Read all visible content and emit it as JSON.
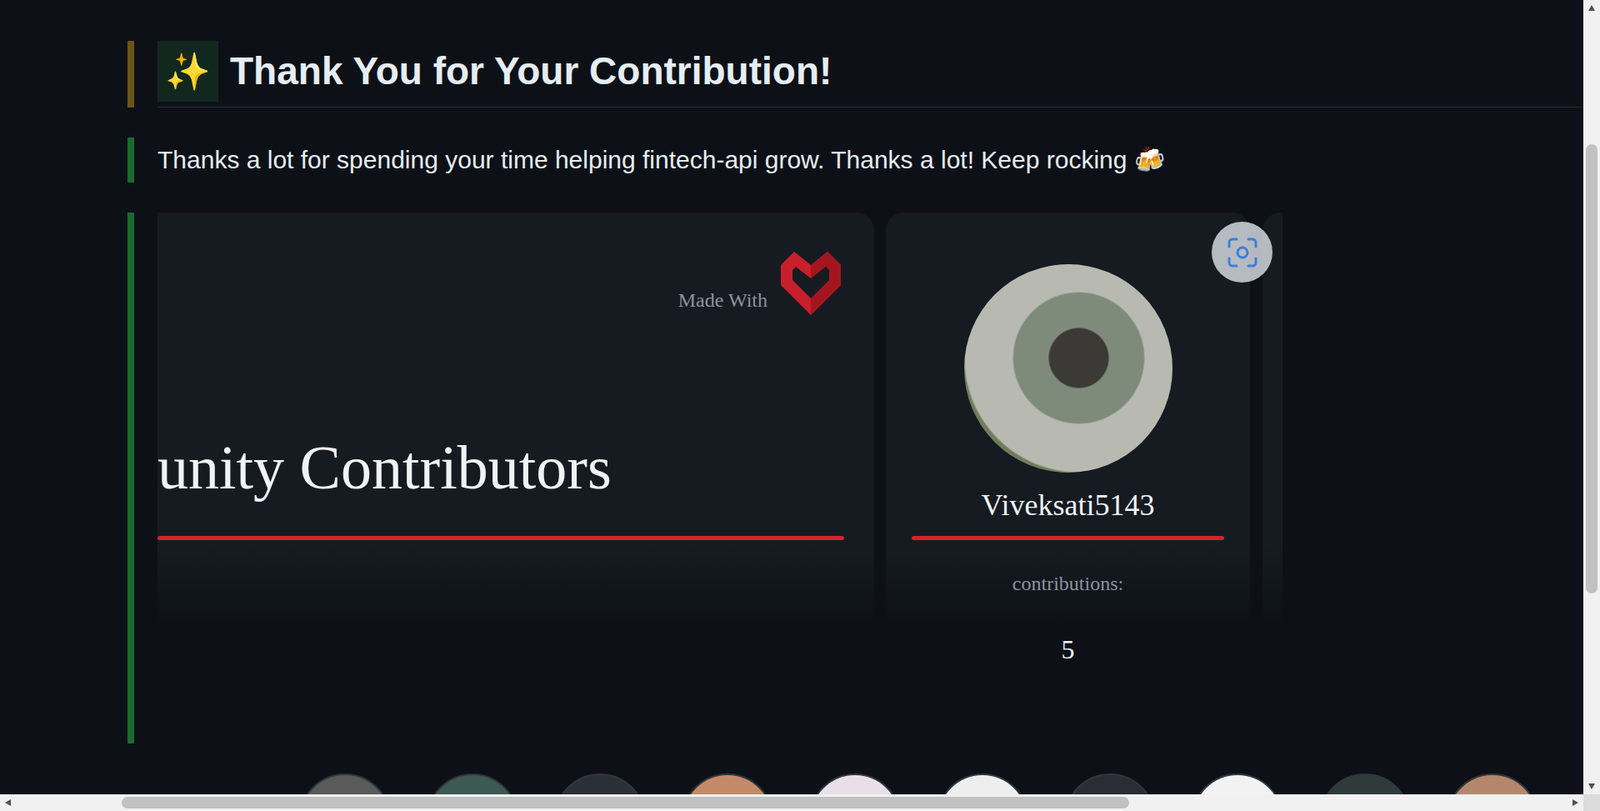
{
  "heading": {
    "icon": "✨",
    "title": "Thank You for Your Contribution!"
  },
  "message": "Thanks a lot for spending your time helping fintech-api grow. Thanks a lot! Keep rocking 🍻",
  "banner": {
    "made_with": "Made With",
    "title": "unity Contributors"
  },
  "contributors": [
    {
      "name": "Viveksati5143",
      "label": "contributions:",
      "count": "5"
    }
  ],
  "avatar_strip": [
    {
      "color": "#5a5a58"
    },
    {
      "color": "#3c5a52"
    },
    {
      "color": "#2b2f36"
    },
    {
      "color": "#c48a68"
    },
    {
      "color": "#e9dfe8"
    },
    {
      "color": "#eeeeee"
    },
    {
      "color": "#2a2d33"
    },
    {
      "color": "#f2f2f2"
    },
    {
      "color": "#2f3b3a"
    },
    {
      "color": "#b4876c"
    }
  ],
  "scrollbars": {
    "vertical": {
      "offset": 0.168,
      "level": 0.59
    },
    "horizontal": {
      "offset": 0.068,
      "level": 0.65
    }
  }
}
